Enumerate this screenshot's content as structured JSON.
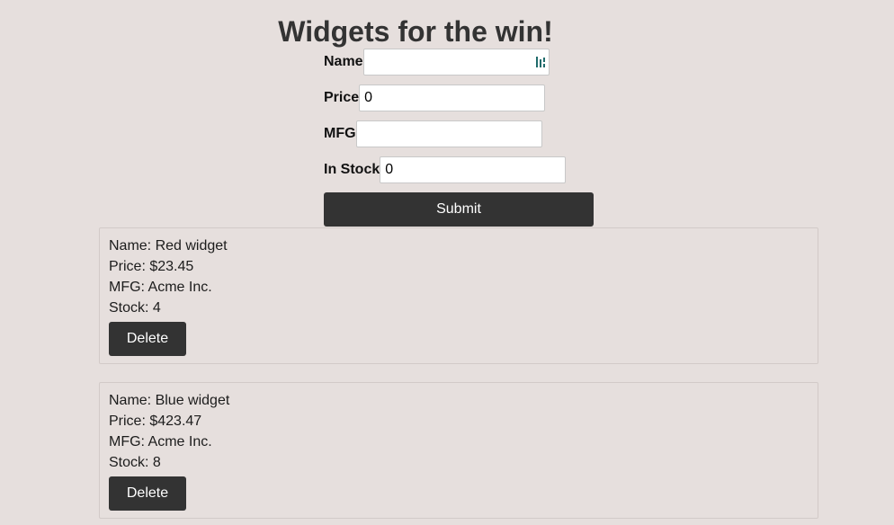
{
  "page": {
    "title": "Widgets for the win!"
  },
  "form": {
    "name_label": "Name",
    "name_value": "",
    "price_label": "Price",
    "price_value": "0",
    "mfg_label": "MFG",
    "mfg_value": "",
    "stock_label": "In Stock",
    "stock_value": "0",
    "submit_label": "Submit",
    "name_field_icon": "password-manager-icon"
  },
  "widgets": [
    {
      "name_line": "Name: Red widget",
      "price_line": "Price: $23.45",
      "mfg_line": "MFG: Acme Inc.",
      "stock_line": "Stock: 4",
      "delete_label": "Delete"
    },
    {
      "name_line": "Name: Blue widget",
      "price_line": "Price: $423.47",
      "mfg_line": "MFG: Acme Inc.",
      "stock_line": "Stock: 8",
      "delete_label": "Delete"
    }
  ],
  "colors": {
    "background": "#e6dfdd",
    "button": "#333333",
    "button_text": "#ffffff",
    "icon_accent": "#1f6b6b"
  }
}
